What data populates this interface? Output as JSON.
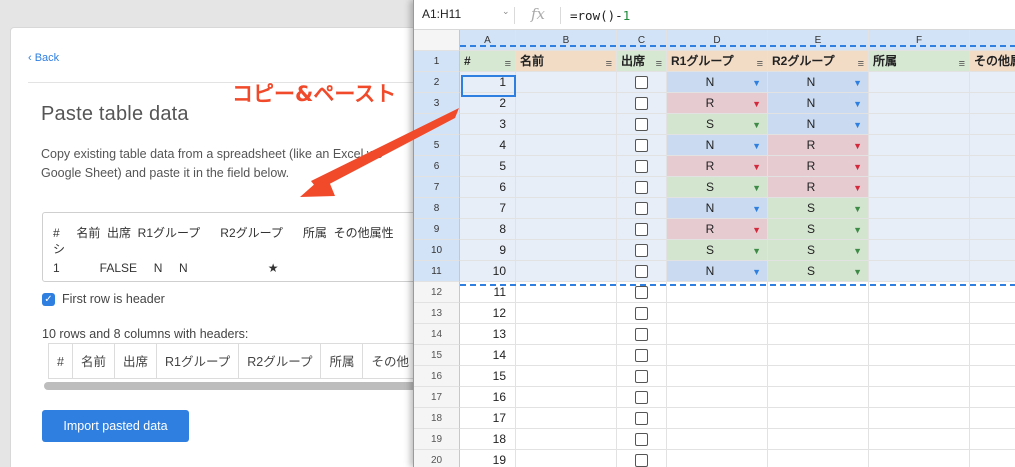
{
  "left_panel": {
    "back_label": "‹ Back",
    "title": "Paste table data",
    "description": "Copy existing table data from a spreadsheet (like an Excel wo Google Sheet) and paste it in the field below.",
    "paste_line1": "#     名前  出席  R1グループ      R2グループ      所属  その他属性",
    "paste_line2": "シ",
    "paste_line3": "1            FALSE     N     N                        ★",
    "header_checkbox_label": "First row is header",
    "header_checkbox_checked": true,
    "rows_summary": "10 rows and 8 columns with headers:",
    "preview_headers": [
      "#",
      "名前",
      "出席",
      "R1グループ",
      "R2グループ",
      "所属",
      "その他"
    ],
    "import_button": "Import pasted data",
    "accent_color": "#2f7fe0"
  },
  "annotation": {
    "label": "コピー&ペースト",
    "color": "#f04a2b"
  },
  "sheet": {
    "name_box": "A1:H11",
    "name_box_caret": "⌄",
    "fx_label": "fx",
    "formula_prefix": "=row()-",
    "formula_number": "1",
    "column_letters": [
      "A",
      "B",
      "C",
      "D",
      "E",
      "F"
    ],
    "headers": [
      "#",
      "名前",
      "出席",
      "R1グループ",
      "R2グループ",
      "所属",
      "その他属"
    ],
    "filter_icon": "≡",
    "rows": [
      {
        "row": "2",
        "num": "1",
        "r1": "N",
        "r2": "N"
      },
      {
        "row": "3",
        "num": "2",
        "r1": "R",
        "r2": "N"
      },
      {
        "row": "4",
        "num": "3",
        "r1": "S",
        "r2": "N"
      },
      {
        "row": "5",
        "num": "4",
        "r1": "N",
        "r2": "R"
      },
      {
        "row": "6",
        "num": "5",
        "r1": "R",
        "r2": "R"
      },
      {
        "row": "7",
        "num": "6",
        "r1": "S",
        "r2": "R"
      },
      {
        "row": "8",
        "num": "7",
        "r1": "N",
        "r2": "S"
      },
      {
        "row": "9",
        "num": "8",
        "r1": "R",
        "r2": "S"
      },
      {
        "row": "10",
        "num": "9",
        "r1": "S",
        "r2": "S"
      },
      {
        "row": "11",
        "num": "10",
        "r1": "N",
        "r2": "S"
      },
      {
        "row": "12",
        "num": "11"
      },
      {
        "row": "13",
        "num": "12"
      },
      {
        "row": "14",
        "num": "13"
      },
      {
        "row": "15",
        "num": "14"
      },
      {
        "row": "16",
        "num": "15"
      },
      {
        "row": "17",
        "num": "16"
      },
      {
        "row": "18",
        "num": "17"
      },
      {
        "row": "19",
        "num": "18"
      },
      {
        "row": "20",
        "num": "19"
      }
    ],
    "group_colors": {
      "N": "#c9daf1",
      "R": "#e6cbd1",
      "S": "#d3e4cf"
    }
  }
}
